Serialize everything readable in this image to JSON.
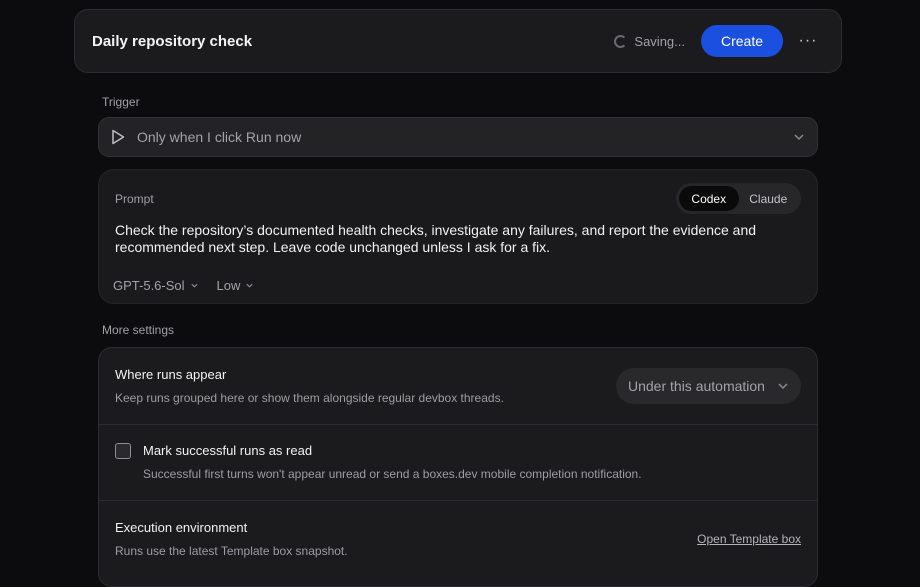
{
  "header": {
    "title": "Daily repository check",
    "saving_label": "Saving...",
    "create_label": "Create",
    "more_label": "···"
  },
  "trigger": {
    "section_label": "Trigger",
    "value": "Only when I click Run now"
  },
  "prompt": {
    "label": "Prompt",
    "agent_options": [
      "Codex",
      "Claude"
    ],
    "agent_selected": "Codex",
    "text": "Check the repository’s documented health checks, investigate any failures, and report the evidence and recommended next step. Leave code unchanged unless I ask for a fix.",
    "model": "GPT-5.6-Sol",
    "effort": "Low"
  },
  "settings": {
    "section_label": "More settings",
    "where": {
      "title": "Where runs appear",
      "description": "Keep runs grouped here or show them alongside regular devbox threads.",
      "value": "Under this automation"
    },
    "mark_read": {
      "title": "Mark successful runs as read",
      "description": "Successful first turns won't appear unread or send a boxes.dev mobile completion notification.",
      "checked": false
    },
    "environment": {
      "title": "Execution environment",
      "description": "Runs use the latest Template box snapshot.",
      "link": "Open Template box"
    }
  },
  "colors": {
    "accent": "#1b4fe0",
    "background": "#0c0c0e",
    "panel": "#1b1b1e"
  },
  "icons": {
    "spinner": "loading-spinner-icon",
    "more": "more-horizontal-icon",
    "play": "play-icon",
    "chevron": "chevron-down-icon"
  }
}
